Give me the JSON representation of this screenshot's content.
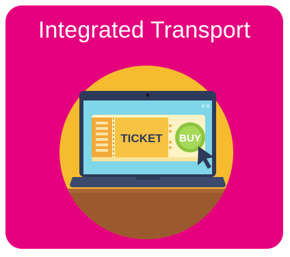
{
  "tile": {
    "title": "Integrated Transport",
    "background_color": "#e5007e"
  },
  "illustration": {
    "ticket_label": "TICKET",
    "buy_label": "BUY",
    "icon_names": [
      "laptop-icon",
      "ticket-icon",
      "buy-button-icon",
      "cursor-icon"
    ],
    "colors": {
      "circle": "#f6bc2e",
      "desk": "#9b5a2d",
      "laptop_frame": "#2e3a5a",
      "screen": "#7fd6e8",
      "ticket": "#fdf3c4",
      "stub": "#f3a93a",
      "buy": "#8cc63f",
      "cursor": "#2e3a5a"
    }
  }
}
